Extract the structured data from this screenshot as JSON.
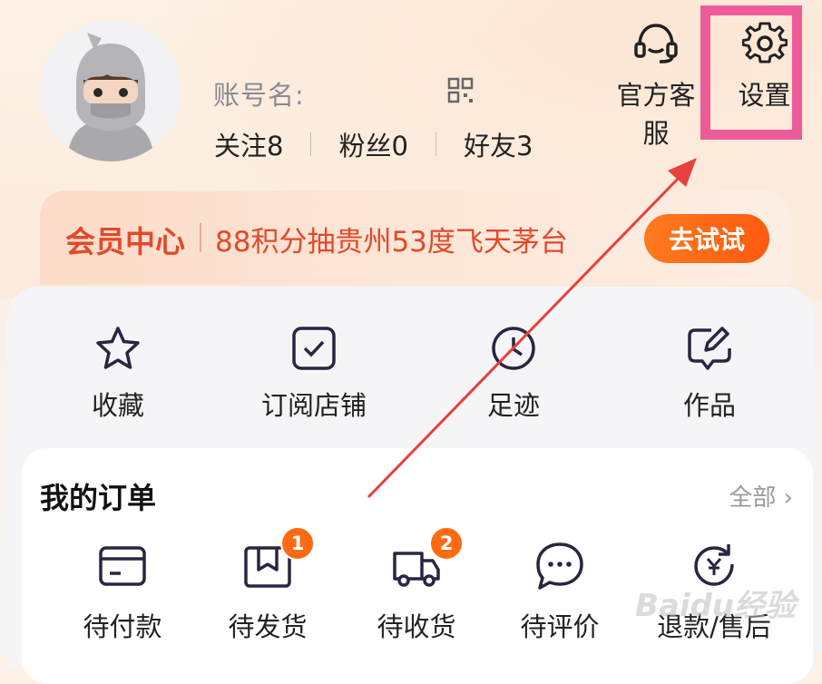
{
  "profile": {
    "account_label": "账号名:",
    "stats": [
      {
        "label": "关注",
        "value": "8"
      },
      {
        "label": "粉丝",
        "value": "0"
      },
      {
        "label": "好友",
        "value": "3"
      }
    ]
  },
  "top_actions": {
    "customer_service": "官方客服",
    "settings": "设置"
  },
  "vip": {
    "title": "会员中心",
    "promo": "88积分抽贵州53度飞天茅台",
    "button": "去试试"
  },
  "shortcuts": [
    {
      "label": "收藏",
      "icon": "star-icon"
    },
    {
      "label": "订阅店铺",
      "icon": "checkbox-icon"
    },
    {
      "label": "足迹",
      "icon": "clock-icon"
    },
    {
      "label": "作品",
      "icon": "edit-icon"
    }
  ],
  "orders": {
    "title": "我的订单",
    "all_label": "全部 ›",
    "items": [
      {
        "label": "待付款",
        "icon": "card-icon",
        "badge": ""
      },
      {
        "label": "待发货",
        "icon": "box-icon",
        "badge": "1"
      },
      {
        "label": "待收货",
        "icon": "truck-icon",
        "badge": "2"
      },
      {
        "label": "待评价",
        "icon": "chat-icon",
        "badge": ""
      },
      {
        "label": "退款/售后",
        "icon": "refund-icon",
        "badge": ""
      }
    ]
  },
  "watermark": "Baidu经验",
  "colors": {
    "accent_orange": "#ff6a12",
    "vip_red": "#e2492b",
    "highlight_pink": "#ee5b9a",
    "arrow_red": "#e8403a"
  }
}
